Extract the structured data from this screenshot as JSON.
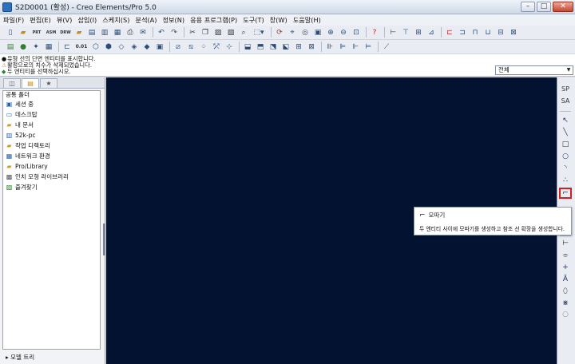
{
  "window": {
    "title": "S2D0001 (활성) - Creo Elements/Pro 5.0",
    "min_btn": "–",
    "max_btn": "□",
    "close_btn": "✕"
  },
  "menu": [
    "파일(F)",
    "편집(E)",
    "뷰(V)",
    "삽입(I)",
    "스케치(S)",
    "분석(A)",
    "정보(N)",
    "응용 프로그램(P)",
    "도구(T)",
    "창(W)",
    "도움말(H)"
  ],
  "toolbar1": {
    "prt_label": "PRT",
    "asm_label": "ASM",
    "drw_label": "DRW"
  },
  "toolbar2": {
    "num_label": "0.01"
  },
  "messages": [
    {
      "marker": "●",
      "text": "유형 선의 단면 엔티티를 표시합니다."
    },
    {
      "marker": "⚠",
      "text": "활정으로의 치수가 삭제되었습니다."
    },
    {
      "marker": "◆",
      "text": "두 엔티티를 선택하십시오."
    }
  ],
  "filter": {
    "value": "전체",
    "arrow": "▼"
  },
  "navigator": {
    "tabs": [
      "◫",
      "▤",
      "★"
    ],
    "header": "공통 폴더",
    "folders": [
      {
        "icon": "▣",
        "label": "세션 중",
        "color": "blue"
      },
      {
        "icon": "▭",
        "label": "데스크탑",
        "color": "blue"
      },
      {
        "icon": "▰",
        "label": "내 문서",
        "color": "yellow"
      },
      {
        "icon": "▥",
        "label": "52k-pc",
        "color": "blue"
      },
      {
        "icon": "▰",
        "label": "작업 디렉토리",
        "color": "yellow"
      },
      {
        "icon": "▦",
        "label": "네트워크 환경",
        "color": "blue"
      },
      {
        "icon": "▰",
        "label": "Pro/Library",
        "color": "yellow"
      },
      {
        "icon": "▩",
        "label": "인치 모형 라이브러리",
        "color": "gray"
      },
      {
        "icon": "▨",
        "label": "즐겨찾기",
        "color": "green"
      }
    ],
    "model_tree": "▸ 모델 트리"
  },
  "right_toolbar": {
    "sp_label": "SP",
    "sa_label": "SA",
    "tools": [
      "↖",
      "╲",
      "□",
      "○",
      "◝",
      "∴",
      "⌐"
    ],
    "tools_lower": [
      "⊢",
      "⌯",
      "+",
      "Ā",
      "⬯",
      "⋇",
      "⎔"
    ]
  },
  "tooltip": {
    "icon": "⌐",
    "title": "모따기",
    "description": "두 엔티티 사이에 모따기를 생성하고 참조 선 확장을 생성합니다."
  }
}
